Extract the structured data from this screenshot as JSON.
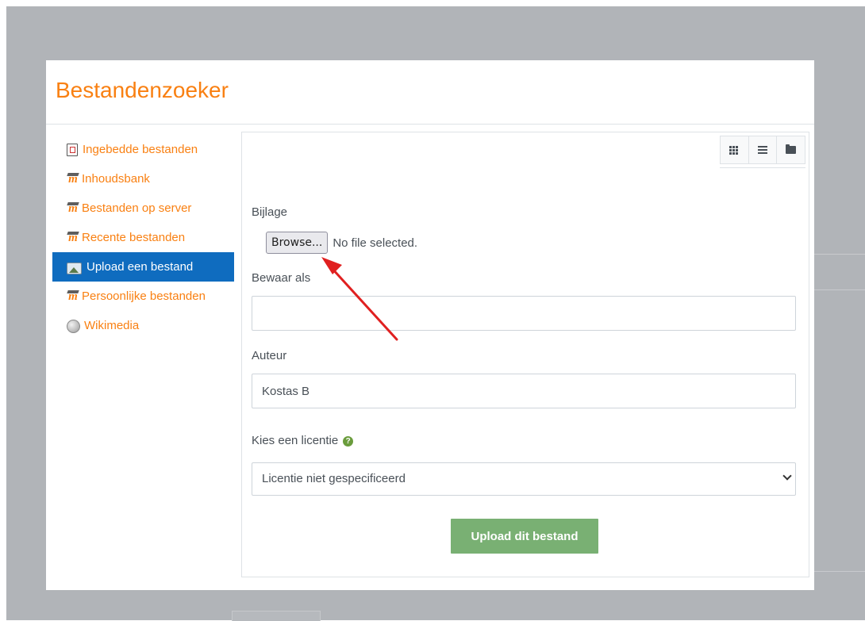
{
  "dialog": {
    "title": "Bestandenzoeker"
  },
  "sidebar": {
    "items": [
      {
        "label": "Ingebedde bestanden",
        "icon": "embedded-files-icon",
        "active": false
      },
      {
        "label": "Inhoudsbank",
        "icon": "moodle-icon",
        "active": false
      },
      {
        "label": "Bestanden op server",
        "icon": "moodle-icon",
        "active": false
      },
      {
        "label": "Recente bestanden",
        "icon": "moodle-icon",
        "active": false
      },
      {
        "label": "Upload een bestand",
        "icon": "upload-icon",
        "active": true
      },
      {
        "label": "Persoonlijke bestanden",
        "icon": "moodle-icon",
        "active": false
      },
      {
        "label": "Wikimedia",
        "icon": "wikimedia-icon",
        "active": false
      }
    ]
  },
  "toolbar": {
    "icons": [
      "grid-view-icon",
      "list-view-icon",
      "folder-view-icon"
    ]
  },
  "form": {
    "attachment_label": "Bijlage",
    "browse_label": "Browse...",
    "browse_status": "No file selected.",
    "save_as_label": "Bewaar als",
    "save_as_value": "",
    "author_label": "Auteur",
    "author_value": "Kostas B",
    "license_label": "Kies een licentie",
    "license_value": "Licentie niet gespecificeerd",
    "upload_button": "Upload dit bestand"
  },
  "colors": {
    "accent": "#f98012",
    "active_item": "#0f6cbf",
    "upload_button": "#79b073",
    "annotation_arrow": "#e02020",
    "help_icon": "#6a9c3c"
  }
}
